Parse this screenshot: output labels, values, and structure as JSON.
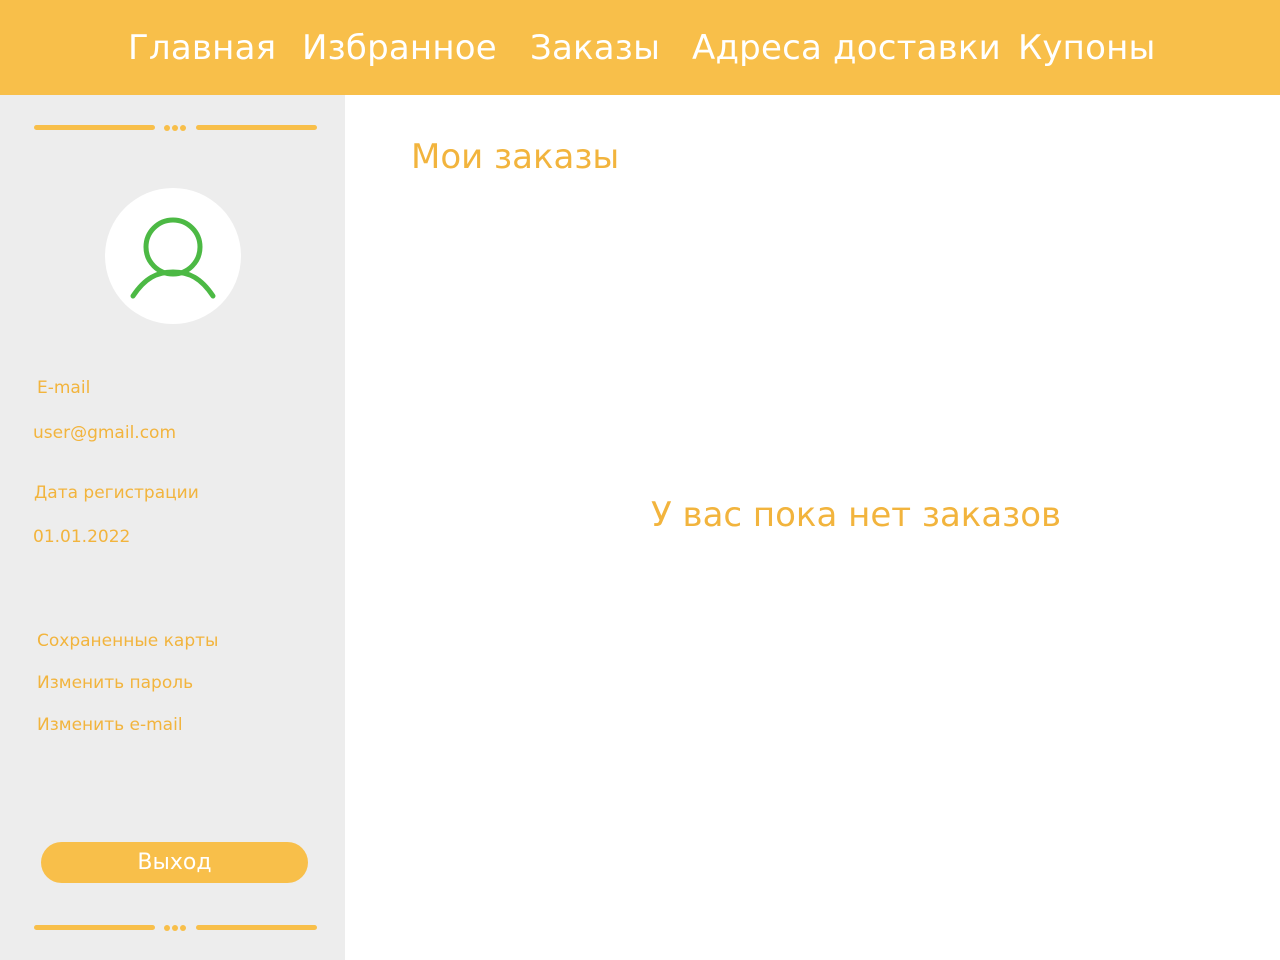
{
  "nav": {
    "items": [
      {
        "label": "Главная"
      },
      {
        "label": "Избранное"
      },
      {
        "label": "Заказы"
      },
      {
        "label": "Адреса доставки"
      },
      {
        "label": "Купоны"
      }
    ]
  },
  "sidebar": {
    "avatar_icon": "user-icon",
    "email_label": "E-mail",
    "email_value": "user@gmail.com",
    "reg_label": "Дата регистрации",
    "reg_value": "01.01.2022",
    "links": [
      {
        "label": "Сохраненные карты"
      },
      {
        "label": "Изменить пароль"
      },
      {
        "label": "Изменить e-mail"
      }
    ],
    "logout_label": "Выход"
  },
  "main": {
    "title": "Мои заказы",
    "empty_message": "У вас пока нет заказов"
  },
  "colors": {
    "accent": "#f8bf4a",
    "accent_text": "#f2b43d",
    "sidebar_bg": "#ededed",
    "avatar_icon": "#4cb944"
  }
}
